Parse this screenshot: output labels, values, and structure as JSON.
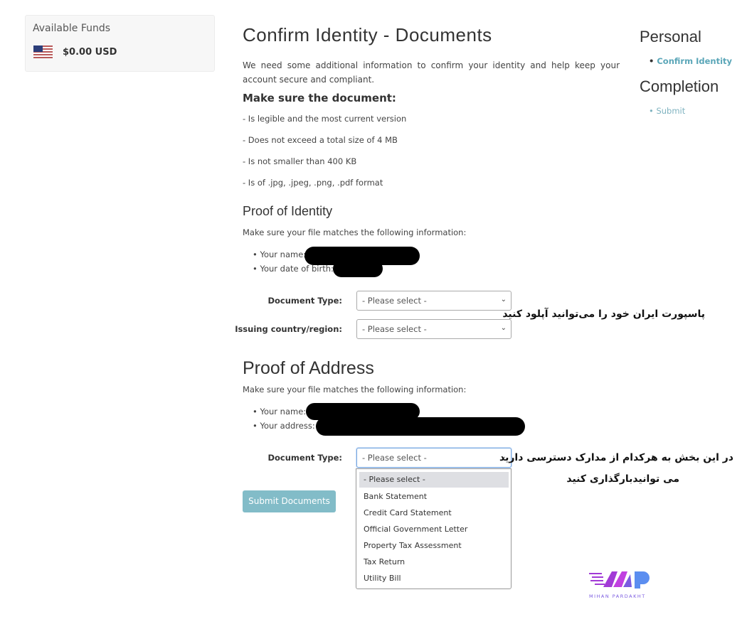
{
  "funds": {
    "title": "Available Funds",
    "amount": "$0.00 USD",
    "flag_icon": "us-flag-icon"
  },
  "main": {
    "title": "Confirm Identity - Documents",
    "intro": "We need some additional information to confirm your identity and help keep your account secure and compliant.",
    "requirements_title": "Make sure the document:",
    "requirements": [
      "- Is legible and the most current version",
      "- Does not exceed a total size of 4 MB",
      "- Is not smaller than 400 KB",
      "- Is of .jpg, .jpeg, .png, .pdf format"
    ],
    "identity": {
      "title": "Proof of Identity",
      "note": "Make sure your file matches the following information:",
      "name_label": "Your name:",
      "dob_label": "Your date of birth:",
      "doc_type_label": "Document Type:",
      "doc_type_value": "- Please select -",
      "country_label": "Issuing country/region:",
      "country_value": "- Please select -"
    },
    "address": {
      "title": "Proof of Address",
      "note": "Make sure your file matches the following information:",
      "name_label": "Your name:",
      "address_label": "Your address:",
      "doc_type_label": "Document Type:",
      "doc_type_value": "- Please select -",
      "options": [
        "- Please select -",
        "Bank Statement",
        "Credit Card Statement",
        "Official Government Letter",
        "Property Tax Assessment",
        "Tax Return",
        "Utility Bill"
      ]
    },
    "submit": "Submit Documents"
  },
  "steps": {
    "personal": "Personal",
    "confirm": "Confirm Identity",
    "completion": "Completion",
    "submit": "Submit",
    "active_color": "#5aa6b8"
  },
  "annotations": {
    "passport": "پاسپورت ایران خود را می‌توانید آپلود کنید",
    "address_line1": "در این بخش به هرکدام از مدارک دسترسی دارید",
    "address_line2": "می توانیدبارگذاری کنید"
  },
  "logo": {
    "text": "MIHAN PARDAKHT"
  }
}
